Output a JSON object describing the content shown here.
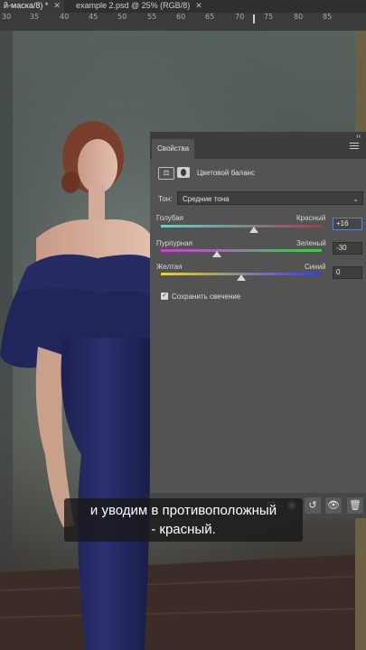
{
  "tabs": [
    {
      "label": "й-маска/8) *",
      "close": "✕",
      "active": true
    },
    {
      "label": "example 2.psd @ 25% (RGB/8)",
      "close": "✕",
      "active": false
    }
  ],
  "ruler": {
    "ticks": [
      "30",
      "35",
      "40",
      "45",
      "50",
      "55",
      "60",
      "65",
      "70",
      "75",
      "80",
      "85"
    ]
  },
  "panel": {
    "title": "Свойства",
    "collapse": "‹‹",
    "adjustment_title": "Цветовой баланс",
    "tone_label": "Тон:",
    "tone_value": "Средние тона",
    "sliders": [
      {
        "left": "Голубая",
        "right": "Красный",
        "value": "+16",
        "level": 16
      },
      {
        "left": "Пурпурная",
        "right": "Зеленый",
        "value": "-30",
        "level": -30
      },
      {
        "left": "Желтая",
        "right": "Синий",
        "value": "0",
        "level": 0
      }
    ],
    "preserve_label": "Сохранить свечение",
    "preserve_checked": true
  },
  "subtitle": {
    "line1": "и уводим в противоположный",
    "line2": "- красный."
  },
  "colors": {
    "panel": "#535353",
    "focus": "#5e86c4"
  }
}
